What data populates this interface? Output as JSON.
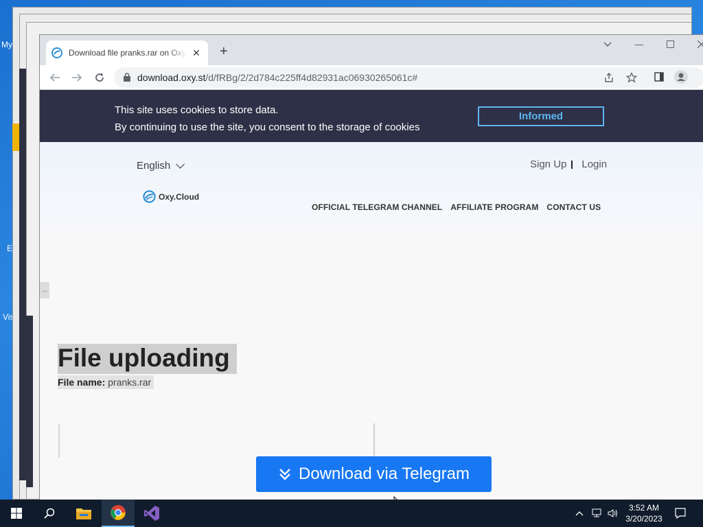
{
  "desktop": {
    "icon_labels": [
      "My",
      "E",
      "Vis"
    ]
  },
  "browser": {
    "tab_title": "Download file pranks.rar on Oxy.Cloud",
    "tab_close": "✕",
    "new_tab": "+",
    "url_host": "download.oxy.st",
    "url_path": "/d/fRBg/2/2d784c225ff4d82931ac06930265061c#"
  },
  "cookie_banner": {
    "line1": "This site uses cookies to store data.",
    "line2": "By continuing to use the site, you consent to the storage of cookies",
    "button": "Informed"
  },
  "header": {
    "language": "English",
    "sign_up": "Sign Up",
    "login": "Login",
    "logo_text": "Oxy.Cloud",
    "menu": [
      "OFFICIAL TELEGRAM CHANNEL",
      "AFFILIATE PROGRAM",
      "CONTACT US"
    ]
  },
  "main": {
    "ellipsis": "...",
    "title": "File uploading",
    "file_name_label": "File name:",
    "file_name": "pranks.rar",
    "download_button": "Download via Telegram"
  },
  "taskbar": {
    "time": "3:52 AM",
    "date": "3/20/2023"
  },
  "colors": {
    "cookie_bg": "#2e3047",
    "accent": "#1877f2",
    "informed_border": "#5db5f0"
  }
}
